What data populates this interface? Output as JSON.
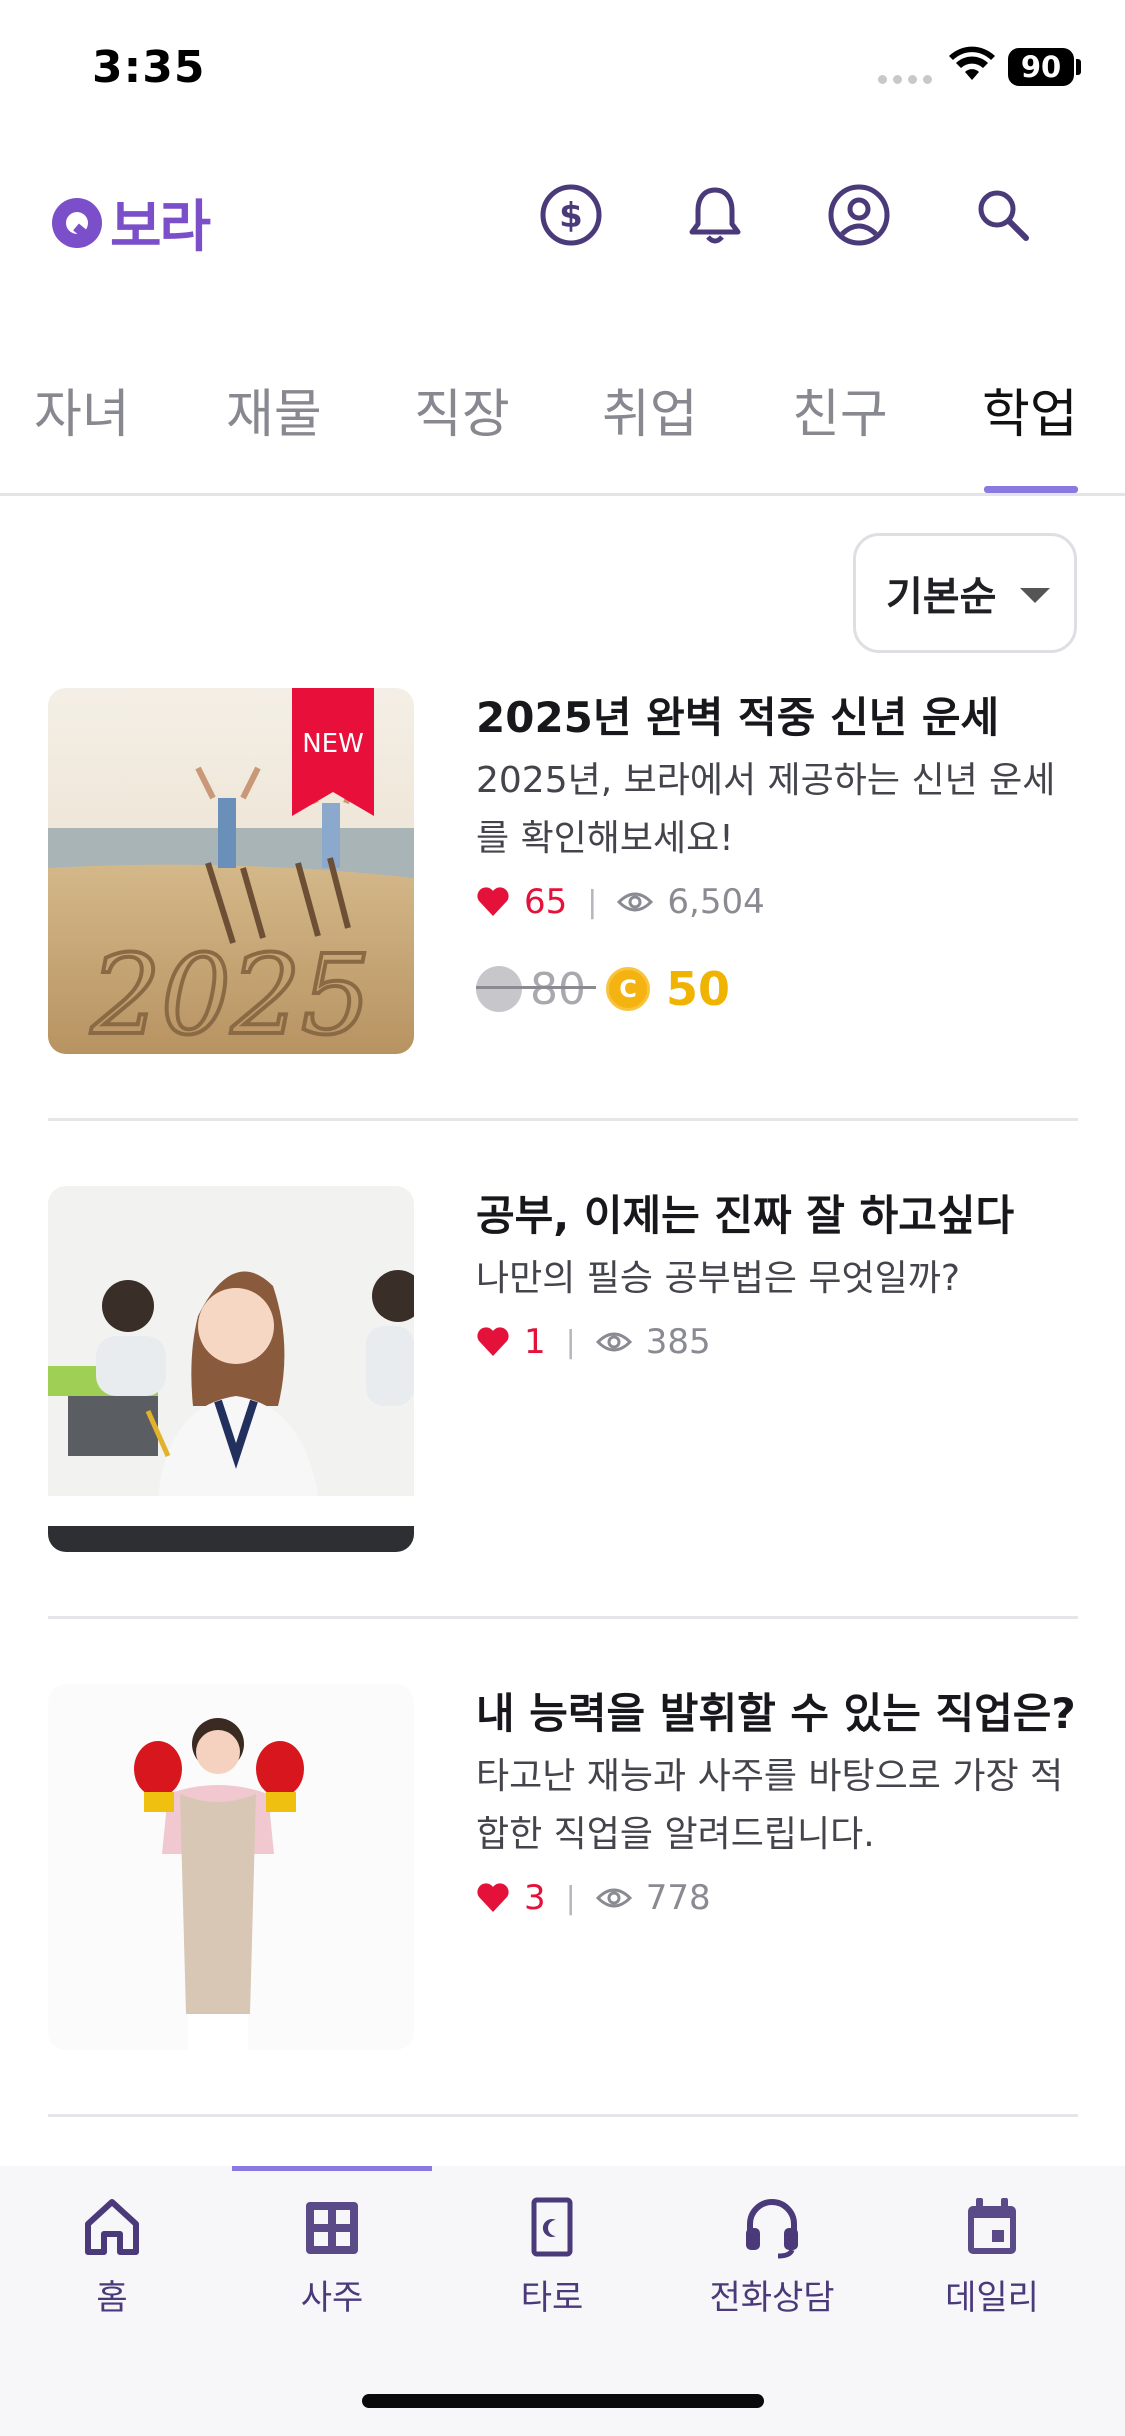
{
  "status_bar": {
    "time": "3:35",
    "battery": "90"
  },
  "header": {
    "logo_text": "보라",
    "icons": [
      "coin-dollar-icon",
      "bell-icon",
      "account-icon",
      "search-icon"
    ],
    "accent_color": "#7b4fc9"
  },
  "tabs": [
    {
      "label": "자녀"
    },
    {
      "label": "재물"
    },
    {
      "label": "직장"
    },
    {
      "label": "취업"
    },
    {
      "label": "친구"
    },
    {
      "label": "학업",
      "active": true
    }
  ],
  "sort": {
    "label": "기본순"
  },
  "cards": [
    {
      "badge": "NEW",
      "thumb_text": "2025",
      "title": "2025년 완벽 적중 신년 운세",
      "description": "2025년, 보라에서 제공하는 신년 운세를 확인해보세요!",
      "likes": "65",
      "views": "6,504",
      "old_price": "80",
      "coin_letter": "C",
      "new_price": "50"
    },
    {
      "title": "공부, 이제는 진짜 잘 하고싶다",
      "description": "나만의 필승 공부법은 무엇일까?",
      "likes": "1",
      "views": "385"
    },
    {
      "title": "내 능력을 발휘할 수 있는 직업은?",
      "description": "타고난 재능과 사주를 바탕으로 가장 적합한 직업을 알려드립니다.",
      "likes": "3",
      "views": "778"
    }
  ],
  "bottom_nav": [
    {
      "label": "홈",
      "icon": "home-icon"
    },
    {
      "label": "사주",
      "icon": "grid-icon",
      "active": true
    },
    {
      "label": "타로",
      "icon": "tarot-card-icon"
    },
    {
      "label": "전화상담",
      "icon": "headset-icon"
    },
    {
      "label": "데일리",
      "icon": "calendar-icon"
    }
  ],
  "colors": {
    "like": "#e4123a",
    "coin": "#f5b312",
    "tab_indicator": "#8a79e0",
    "nav_text": "#4a3a7a"
  }
}
